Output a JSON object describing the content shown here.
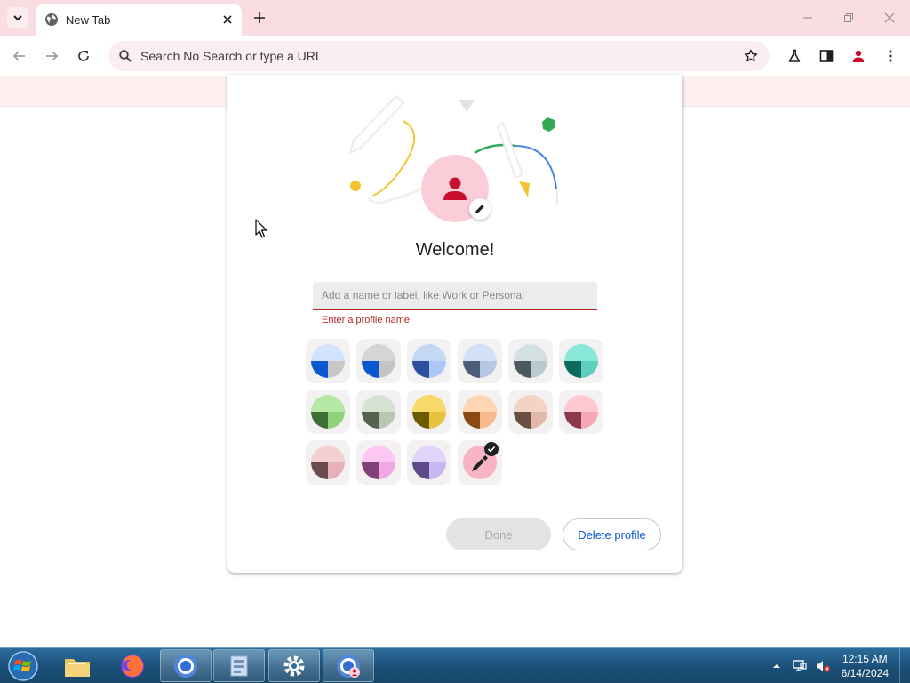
{
  "browser": {
    "tab": {
      "title": "New Tab"
    },
    "omnibox": {
      "text": "Search No Search or type a URL"
    },
    "icons": [
      "tab-search-icon",
      "globe-icon",
      "close-icon",
      "plus-icon",
      "minimize-icon",
      "restore-icon",
      "window-close-icon",
      "back-icon",
      "forward-icon",
      "reload-icon",
      "search-icon",
      "star-icon",
      "labs-flask-icon",
      "side-panel-icon",
      "profile-icon",
      "more-menu-icon"
    ]
  },
  "dialog": {
    "title": "Welcome!",
    "name_input": {
      "placeholder": "Add a name or label, like Work or Personal",
      "value": ""
    },
    "error": "Enter a profile name",
    "themes": [
      {
        "id": "default-blue",
        "top": "#d3e3fd",
        "bl": "#0b57d0",
        "br": "#c7c7c7",
        "selected": false
      },
      {
        "id": "grey-blue",
        "top": "#d5d5d5",
        "bl": "#0b57d0",
        "br": "#c4c4c4",
        "selected": false
      },
      {
        "id": "blue",
        "top": "#c4d7f5",
        "bl": "#2d4f9c",
        "br": "#adc6fa",
        "selected": false
      },
      {
        "id": "slate-blue",
        "top": "#d3e0f7",
        "bl": "#4d5c78",
        "br": "#b7c6e2",
        "selected": false
      },
      {
        "id": "grey",
        "top": "#d5e0e3",
        "bl": "#4b5961",
        "br": "#b9c9cf",
        "selected": false
      },
      {
        "id": "teal",
        "top": "#8ae8da",
        "bl": "#0c6b5d",
        "br": "#5fcfbe",
        "selected": false
      },
      {
        "id": "green",
        "top": "#b5e8a6",
        "bl": "#3d6e34",
        "br": "#8fd27e",
        "selected": false
      },
      {
        "id": "sage",
        "top": "#d7e3d2",
        "bl": "#55634f",
        "br": "#b8c7b1",
        "selected": false
      },
      {
        "id": "yellow",
        "top": "#f7d96a",
        "bl": "#6a5a00",
        "br": "#e7c23f",
        "selected": false
      },
      {
        "id": "orange",
        "top": "#ffd5b3",
        "bl": "#8a4a12",
        "br": "#f7b98b",
        "selected": false
      },
      {
        "id": "beige",
        "top": "#f4d3c5",
        "bl": "#6a4d43",
        "br": "#e2b9a9",
        "selected": false
      },
      {
        "id": "rose",
        "top": "#ffc9d2",
        "bl": "#8b3a4b",
        "br": "#f6a6b5",
        "selected": false
      },
      {
        "id": "pink",
        "top": "#f6cfd3",
        "bl": "#6b4b50",
        "br": "#e6b2b8",
        "selected": false
      },
      {
        "id": "magenta",
        "top": "#fcc7f0",
        "bl": "#82407a",
        "br": "#f1a7e3",
        "selected": false
      },
      {
        "id": "lavender",
        "top": "#e1d4fb",
        "bl": "#5c4a8a",
        "br": "#c8b6f4",
        "selected": false
      },
      {
        "id": "custom-color",
        "top": "#f8b3c4",
        "bl": "#f8b3c4",
        "br": "#f8b3c4",
        "selected": true,
        "icon": "eyedropper-icon"
      }
    ],
    "buttons": {
      "done": "Done",
      "delete": "Delete profile"
    },
    "colors": {
      "avatar_bg": "#fbcdd8",
      "avatar_icon": "#c8102e",
      "error": "#b3261e",
      "link_blue": "#0b57d0"
    }
  },
  "taskbar": {
    "items": [
      "start-orb",
      "file-explorer",
      "firefox",
      "chrome",
      "control-panel",
      "settings",
      "chrome-profile"
    ],
    "clock": {
      "time": "12:15 AM",
      "date": "6/14/2024"
    }
  }
}
